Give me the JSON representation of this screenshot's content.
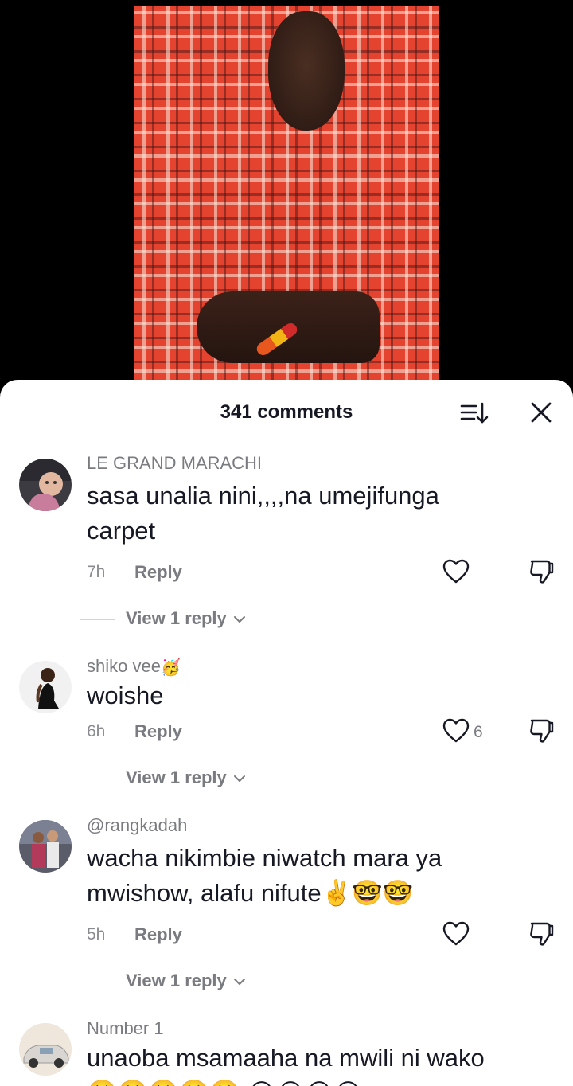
{
  "header": {
    "comments_count_label": "341 comments"
  },
  "icons": {
    "sort": "sort-icon",
    "close": "close-icon",
    "like": "heart-icon",
    "dislike": "thumbs-down-icon",
    "chevron": "chevron-down-icon"
  },
  "comments": [
    {
      "username": "LE GRAND MARACHI",
      "text": "sasa unalia nini,,,,na umejifunga carpet",
      "time": "7h",
      "reply_label": "Reply",
      "like_count": "",
      "view_replies": "View 1 reply"
    },
    {
      "username": "shiko vee",
      "username_emoji": "🥳",
      "text": "woishe",
      "time": "6h",
      "reply_label": "Reply",
      "like_count": "6",
      "view_replies": "View 1 reply"
    },
    {
      "username": "@rangkadah",
      "text": "wacha nikimbie niwatch mara ya mwishow, alafu nifute",
      "text_emoji": "✌️🤓🤓",
      "time": "5h",
      "reply_label": "Reply",
      "like_count": "",
      "view_replies": "View 1 reply"
    },
    {
      "username": "Number 1",
      "text": "unaoba msamaaha na mwili ni wako",
      "text_emoji": "🥺🥺🥺🥺🥺 😭😭😭😭"
    }
  ]
}
